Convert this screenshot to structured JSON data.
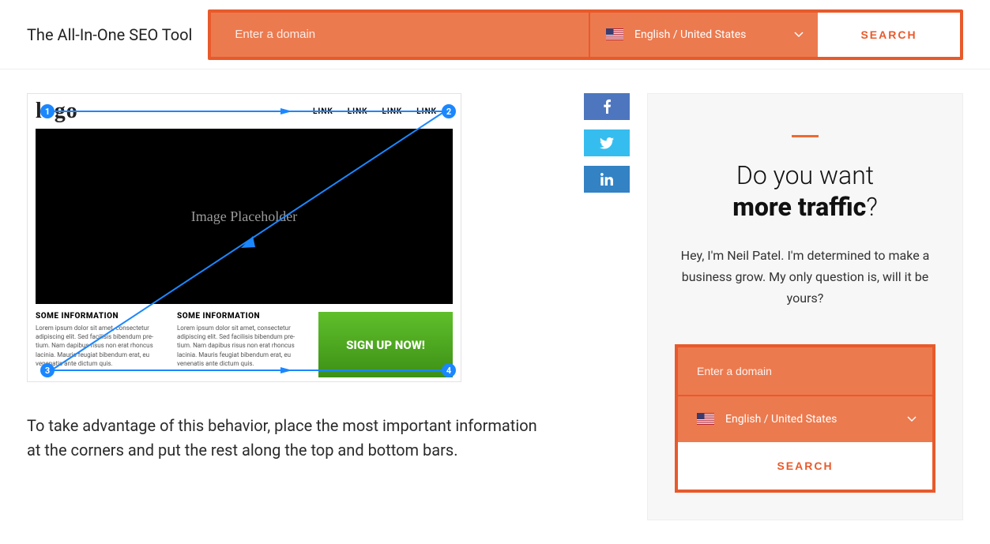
{
  "topbar": {
    "title": "The All-In-One SEO Tool",
    "search_placeholder": "Enter a domain",
    "region_label": "English / United States",
    "search_btn": "SEARCH"
  },
  "mock": {
    "logo": "logo",
    "nav": [
      "LINK",
      "LINK",
      "LINK",
      "LINK"
    ],
    "hero": "Image Placeholder",
    "info_heading": "SOME INFORMATION",
    "info_body": "Lorem ipsum dolor sit amet, consectetur adipiscing elit. Sed facilisis bibendum pre-tium. Nam dapibus risus non erat rhoncus lacinia. Mauris feugiat bibendum erat, eu venenatis ante dictum quis.",
    "cta": "SIGN UP NOW!",
    "badges": [
      "1",
      "2",
      "3",
      "4"
    ]
  },
  "article": {
    "paragraph": "To take advantage of this behavior, place the most important information at the corners and put the rest along the top and bottom bars."
  },
  "sidecard": {
    "heading_pre": "Do you want",
    "heading_bold": "more traffic",
    "heading_suf": "?",
    "desc": "Hey, I'm Neil Patel. I'm determined to make a business grow. My only question is, will it be yours?",
    "search_placeholder": "Enter a domain",
    "region_label": "English / United States",
    "search_btn": "SEARCH"
  },
  "social": {
    "facebook": "facebook",
    "twitter": "twitter",
    "linkedin": "linkedin"
  }
}
